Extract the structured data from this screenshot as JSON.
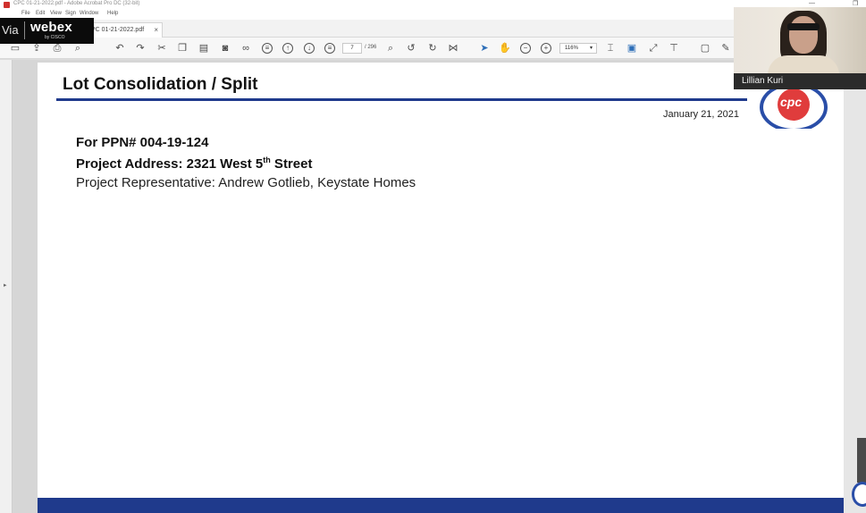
{
  "window": {
    "title": "CPC 01-21-2022.pdf - Adobe Acrobat Pro DC (32-bit)",
    "minimize": "—",
    "restore": "❐"
  },
  "menu": {
    "items": [
      "File",
      "Edit",
      "View",
      "Sign",
      "Window",
      "Help"
    ]
  },
  "tab": {
    "label": "PC 01-21-2022.pdf",
    "close": "×"
  },
  "toolbar": {
    "page_current": "7",
    "page_total": "/ 296",
    "zoom": "116%",
    "zoom_caret": "▾"
  },
  "webex": {
    "via": "Via",
    "brand": "webex",
    "by": "by CISCO"
  },
  "slide": {
    "title": "Lot Consolidation / Split",
    "date": "January 21, 2021",
    "ppn": "For PPN# 004-19-124",
    "address_prefix": "Project Address: 2321 West 5",
    "address_sup": "th",
    "address_suffix": " Street",
    "representative": "Project Representative: Andrew Gotlieb, Keystate Homes",
    "logo_text": "cpc"
  },
  "video": {
    "participant_name": "Lillian Kuri"
  },
  "colors": {
    "accent_blue": "#1f3a8c",
    "logo_red": "#e03c3c",
    "acrobat_blue": "#2e6fb8"
  }
}
